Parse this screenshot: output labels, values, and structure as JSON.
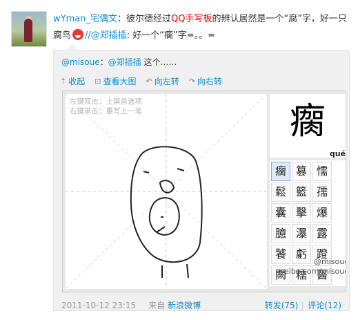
{
  "post": {
    "author": "wYman_宅偶文",
    "colon": "：",
    "text_a": "彼尔德经过",
    "highlight": "QQ手写板",
    "text_b": "的辨认居然是一个“腐”字，好一只腐鸟",
    "mention_prefix": "//@郑插插",
    "text_c": ": 好一个“瘸”字=。。="
  },
  "quote": {
    "mention_user": "@misoue",
    "sep": "：",
    "mention_target": "@郑插插",
    "text": " 这个……",
    "toolbar": {
      "collapse": "收起",
      "view_large": "查看大图",
      "rotate_left": "向左转",
      "rotate_right": "向右转"
    },
    "image": {
      "hint_line1": "左键双击：上屏首选项",
      "hint_line2": "右键单击：重写上一笔",
      "main_char": "瘸",
      "pinyin_fragment": "qué",
      "candidates": [
        "瘸",
        "篡",
        "懦",
        "鬆",
        "籃",
        "孺",
        "囊",
        "擊",
        "爆",
        "臆",
        "瀑",
        "露",
        "饕",
        "虧",
        "蹬",
        "闕",
        "糯",
        "醫"
      ],
      "watermark_line1": "@misoue",
      "watermark_line2": "weibo.com/misoue"
    },
    "footer": {
      "timestamp": "2011-10-12 23:15",
      "from_label": "来自",
      "source": "新浪微博",
      "forward": "转发(75)",
      "divider": "|",
      "comment": "评论(12)"
    }
  },
  "colors": {
    "link": "#0a8cd2",
    "highlight": "#e60000"
  }
}
